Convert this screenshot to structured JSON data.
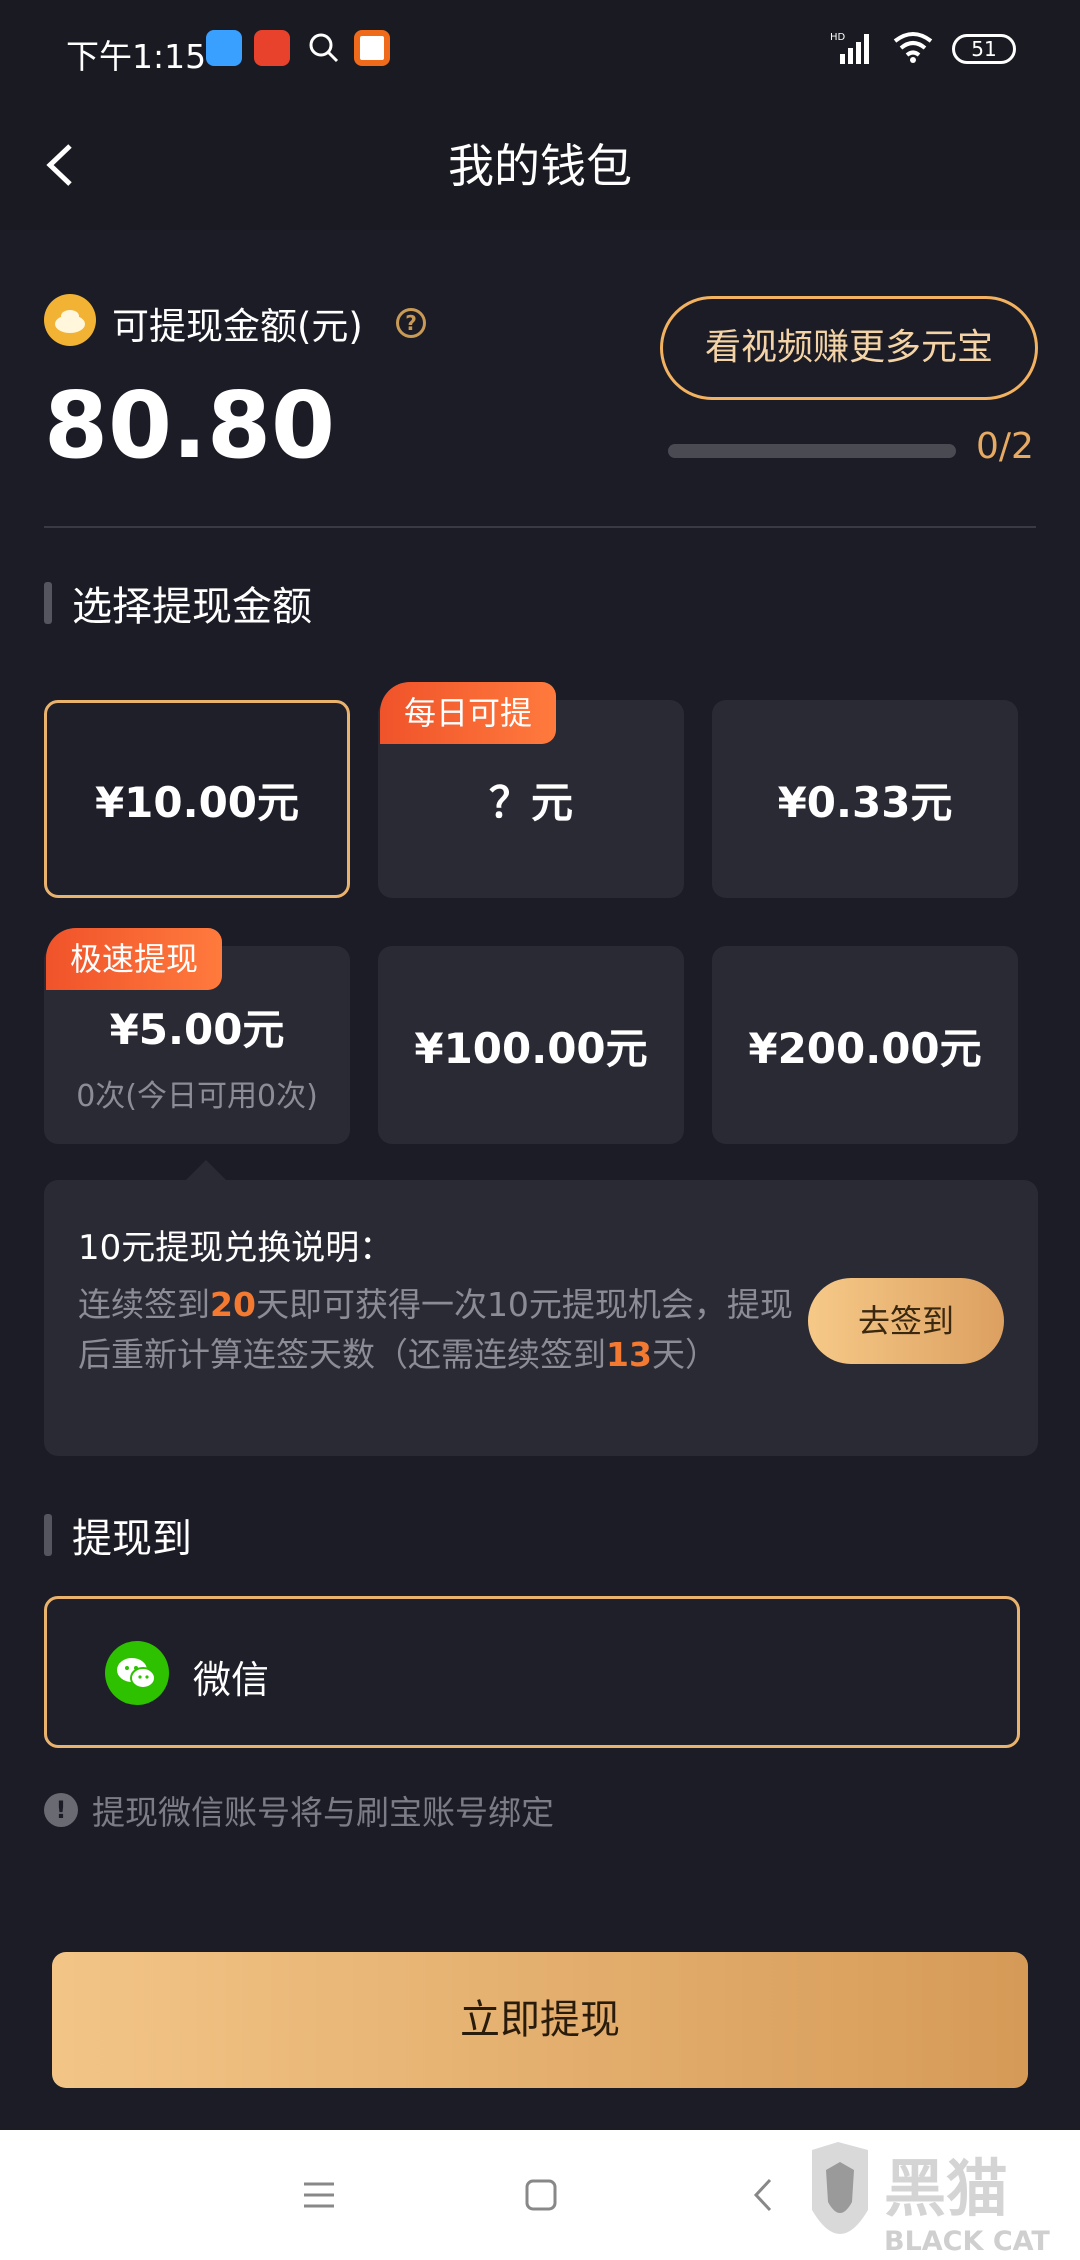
{
  "status_bar": {
    "time": "下午1:15",
    "network": "HD",
    "battery": "51"
  },
  "header": {
    "title": "我的钱包"
  },
  "balance": {
    "label": "可提现金额(元)",
    "value": "80.80"
  },
  "video_task": {
    "button_label": "看视频赚更多元宝",
    "progress_text": "0/2",
    "progress_done": 0,
    "progress_total": 2
  },
  "select_section": {
    "title": "选择提现金额",
    "options": [
      {
        "amount": "¥10.00元",
        "selected": true
      },
      {
        "amount": "？元",
        "tag": "每日可提"
      },
      {
        "amount": "¥0.33元"
      },
      {
        "amount": "¥5.00元",
        "tag": "极速提现",
        "sub": "0次(今日可用0次)"
      },
      {
        "amount": "¥100.00元"
      },
      {
        "amount": "¥200.00元"
      }
    ]
  },
  "explanation": {
    "title": "10元提现兑换说明：",
    "text_1": "连续签到",
    "days_required": "20",
    "text_2": "天即可获得一次10元提现机会，提现后重新计算连签天数（还需连续签到",
    "days_remaining": "13",
    "text_3": "天）",
    "signin_button": "去签到"
  },
  "withdraw_to": {
    "title": "提现到",
    "method": "微信"
  },
  "notice": "提现微信账号将与刷宝账号绑定",
  "withdraw_button": "立即提现",
  "watermark": {
    "cn": "黑猫",
    "en": "BLACK CAT"
  },
  "colors": {
    "background": "#1c1c26",
    "card": "#2a2a34",
    "accent_gold": "#e9b26d",
    "tag_orange": "#f0532a",
    "wechat_green": "#2dc100"
  }
}
